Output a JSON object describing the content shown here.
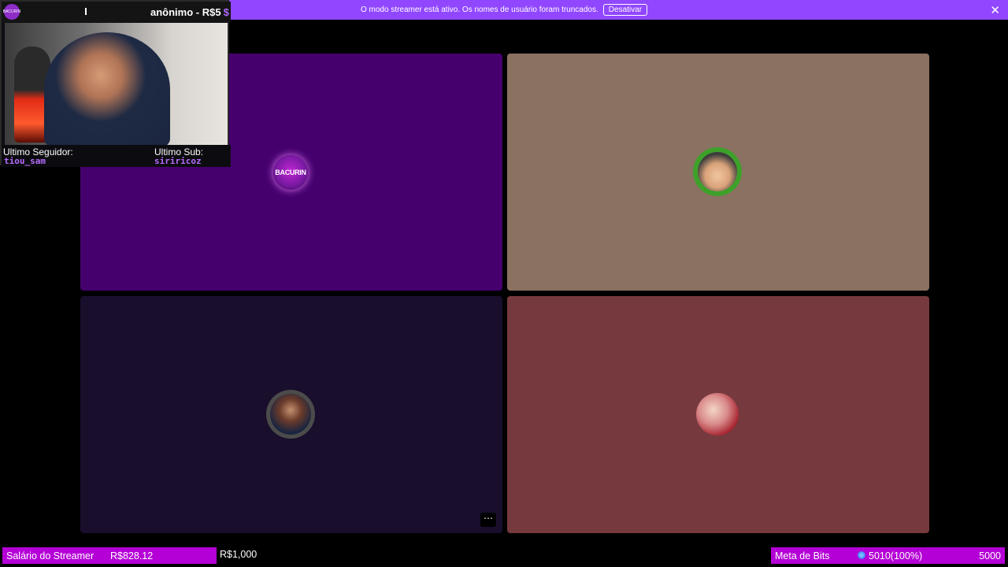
{
  "banner": {
    "message": "O modo streamer está ativo. Os nomes de usuário foram truncados.",
    "button": "Desativar",
    "close": "✕"
  },
  "tiles": [
    {
      "name": "participant-1",
      "avatar": "bacurin-logo-icon",
      "logo_text": "BACURIN"
    },
    {
      "name": "participant-2",
      "avatar": "avatar-icon"
    },
    {
      "name": "participant-3",
      "avatar": "avatar-icon",
      "more": "⋯"
    },
    {
      "name": "participant-4",
      "avatar": "avatar-icon"
    }
  ],
  "overlay": {
    "logo_text": "BACURIN",
    "donation": "anônimo - R$5",
    "donation_icon": "$",
    "last_follower_label": "Ultimo Seguidor:",
    "last_follower": "tiou_sam",
    "last_sub_label": "Ultimo Sub:",
    "last_sub": "siriricoz"
  },
  "bottom": {
    "salary_label": "Salário do Streamer",
    "salary_value": "R$828.12",
    "salary_goal": "R$1,000",
    "bits_label": "Meta de Bits",
    "bits_value": "5010(100%)",
    "bits_goal": "5000"
  },
  "colors": {
    "banner": "#9147ff",
    "tile1": "#45006e",
    "tile2": "#8b7161",
    "tile3": "#190e2c",
    "tile4": "#763a3e",
    "bar": "#b400d6"
  }
}
